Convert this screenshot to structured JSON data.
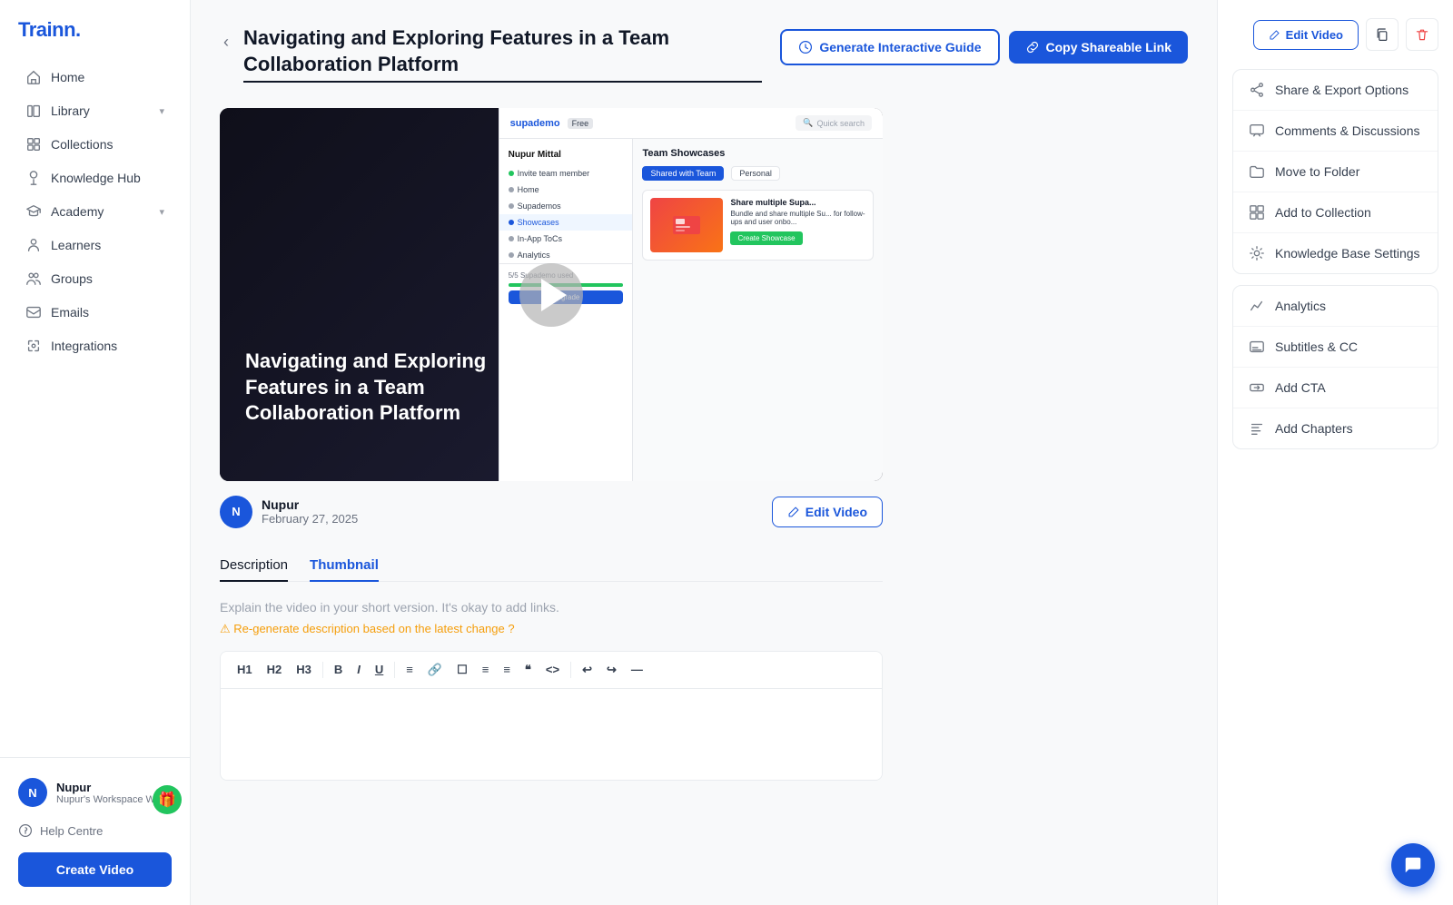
{
  "app": {
    "logo": "Trainn.",
    "chat_icon": "💬"
  },
  "sidebar": {
    "nav_items": [
      {
        "id": "home",
        "label": "Home",
        "icon": "home",
        "has_chevron": false
      },
      {
        "id": "library",
        "label": "Library",
        "icon": "library",
        "has_chevron": true
      },
      {
        "id": "collections",
        "label": "Collections",
        "icon": "collections",
        "has_chevron": false
      },
      {
        "id": "knowledge_hub",
        "label": "Knowledge Hub",
        "icon": "knowledge",
        "has_chevron": false
      },
      {
        "id": "academy",
        "label": "Academy",
        "icon": "academy",
        "has_chevron": true
      },
      {
        "id": "learners",
        "label": "Learners",
        "icon": "learners",
        "has_chevron": false
      },
      {
        "id": "groups",
        "label": "Groups",
        "icon": "groups",
        "has_chevron": false
      },
      {
        "id": "emails",
        "label": "Emails",
        "icon": "emails",
        "has_chevron": false
      },
      {
        "id": "integrations",
        "label": "Integrations",
        "icon": "integrations",
        "has_chevron": false
      }
    ],
    "user": {
      "name": "Nupur",
      "workspace": "Nupur's Workspace Workspace",
      "avatar_initial": "N"
    },
    "help": "Help Centre",
    "create_button": "Create Video"
  },
  "header": {
    "back_label": "‹",
    "title": "Navigating and Exploring Features in a Team Collaboration Platform",
    "generate_button": "Generate Interactive Guide",
    "copy_button": "Copy Shareable Link"
  },
  "video": {
    "overlay_text": "Navigating and Exploring Features in a Team Collaboration Platform",
    "author": {
      "name": "Nupur",
      "avatar_initial": "N",
      "date": "February 27, 2025"
    },
    "edit_button": "Edit Video",
    "mock_ui": {
      "logo": "supademo",
      "badge": "Free",
      "search_placeholder": "Quick search",
      "sidebar_user": "Nupur Mittal",
      "sidebar_items": [
        "Invite team member",
        "Home",
        "Supademos",
        "Showcases",
        "In-App ToCs",
        "Analytics"
      ],
      "content_title": "Team Showcases",
      "tabs": [
        "Shared with Team",
        "Personal"
      ],
      "card_title": "Share multiple Supa...",
      "card_text": "Bundle and share multiple Su... for follow-ups and user onbo...",
      "card_button": "Create Showcase",
      "progress_label": "5/5 Supademo used",
      "upgrade_label": "Upgrade"
    }
  },
  "right_panel": {
    "edit_button": "Edit Video",
    "copy_icon": "⧉",
    "trash_icon": "🗑",
    "menu_items": [
      {
        "id": "share",
        "label": "Share & Export Options",
        "icon": "share"
      },
      {
        "id": "comments",
        "label": "Comments & Discussions",
        "icon": "comments"
      },
      {
        "id": "move",
        "label": "Move to Folder",
        "icon": "folder"
      },
      {
        "id": "collection",
        "label": "Add to Collection",
        "icon": "collection"
      },
      {
        "id": "kb_settings",
        "label": "Knowledge Base Settings",
        "icon": "settings"
      }
    ],
    "menu_items2": [
      {
        "id": "analytics",
        "label": "Analytics",
        "icon": "analytics"
      },
      {
        "id": "subtitles",
        "label": "Subtitles & CC",
        "icon": "subtitles"
      },
      {
        "id": "add_cta",
        "label": "Add CTA",
        "icon": "cta"
      },
      {
        "id": "add_chapters",
        "label": "Add Chapters",
        "icon": "chapters"
      }
    ]
  },
  "tabs": [
    {
      "id": "description",
      "label": "Description",
      "active": false,
      "completed": true
    },
    {
      "id": "thumbnail",
      "label": "Thumbnail",
      "active": true,
      "completed": false
    }
  ],
  "description": {
    "placeholder": "Explain the video in your short version. It's okay to add links.",
    "regen_label": "⚠ Re-generate description based on the latest change ?",
    "toolbar": [
      "H1",
      "H2",
      "H3",
      "B",
      "I",
      "U",
      "≡",
      "🔗",
      "☐",
      "≡",
      "≡",
      "\"",
      "<>",
      "↩",
      "↪",
      "—"
    ]
  }
}
